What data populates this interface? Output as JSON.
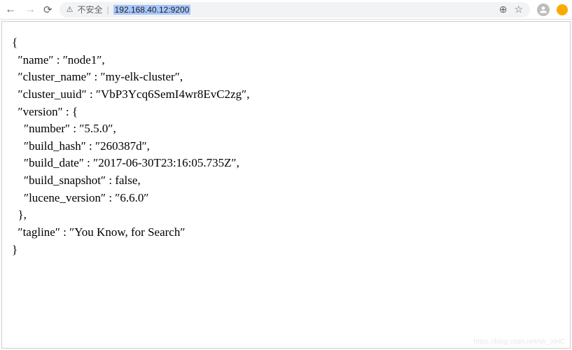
{
  "browser": {
    "insecure_label": "不安全",
    "url": "192.168.40.12:9200"
  },
  "json_body": {
    "name": "node1",
    "cluster_name": "my-elk-cluster",
    "cluster_uuid": "VbP3Ycq6SemI4wr8EvC2zg",
    "version": {
      "number": "5.5.0",
      "build_hash": "260387d",
      "build_date": "2017-06-30T23:16:05.735Z",
      "build_snapshot": false,
      "lucene_version": "6.6.0"
    },
    "tagline": "You Know, for Search"
  },
  "watermark": "https://blog.csdn.net/Mr_XHC"
}
